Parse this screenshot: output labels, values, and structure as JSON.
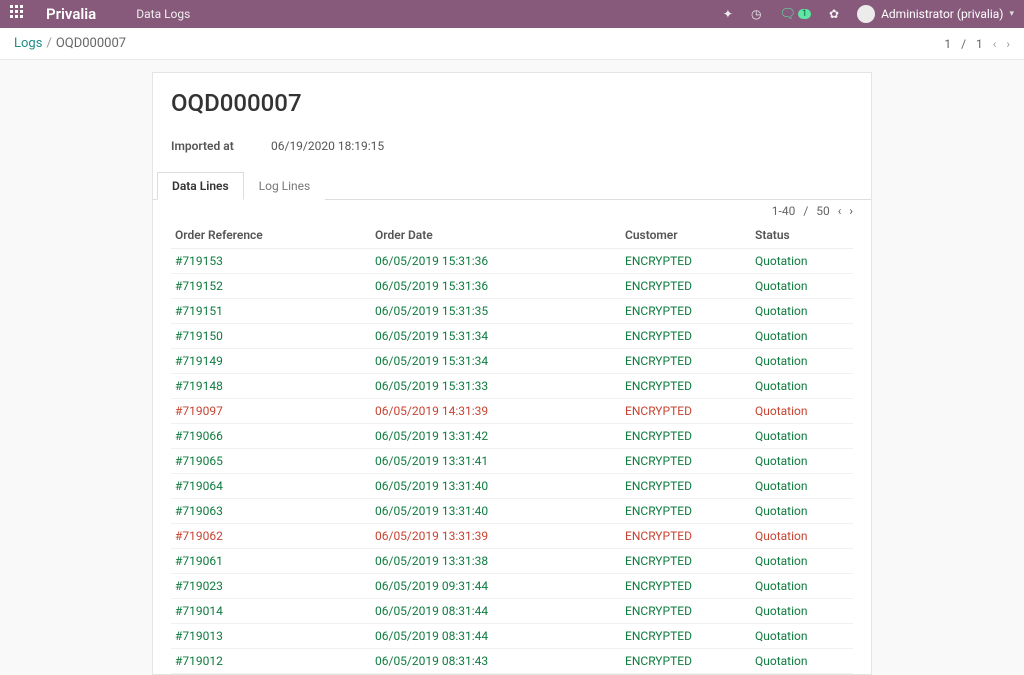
{
  "navbar": {
    "brand": "Privalia",
    "menu": "Data Logs",
    "chat_badge": "1",
    "user": "Administrator (privalia)"
  },
  "breadcrumb": {
    "root": "Logs",
    "current": "OQD000007"
  },
  "pager_top": {
    "value": "1",
    "total": "1"
  },
  "record": {
    "title": "OQD000007",
    "imported_at_label": "Imported at",
    "imported_at": "06/19/2020 18:19:15"
  },
  "tabs": {
    "data_lines": "Data Lines",
    "log_lines": "Log Lines"
  },
  "table_pager": {
    "range": "1-40",
    "total": "50"
  },
  "columns": {
    "ref": "Order Reference",
    "date": "Order Date",
    "cust": "Customer",
    "status": "Status"
  },
  "rows": [
    {
      "ref": "#719153",
      "date": "06/05/2019 15:31:36",
      "cust": "ENCRYPTED",
      "status": "Quotation",
      "tone": "green"
    },
    {
      "ref": "#719152",
      "date": "06/05/2019 15:31:36",
      "cust": "ENCRYPTED",
      "status": "Quotation",
      "tone": "green"
    },
    {
      "ref": "#719151",
      "date": "06/05/2019 15:31:35",
      "cust": "ENCRYPTED",
      "status": "Quotation",
      "tone": "green"
    },
    {
      "ref": "#719150",
      "date": "06/05/2019 15:31:34",
      "cust": "ENCRYPTED",
      "status": "Quotation",
      "tone": "green"
    },
    {
      "ref": "#719149",
      "date": "06/05/2019 15:31:34",
      "cust": "ENCRYPTED",
      "status": "Quotation",
      "tone": "green"
    },
    {
      "ref": "#719148",
      "date": "06/05/2019 15:31:33",
      "cust": "ENCRYPTED",
      "status": "Quotation",
      "tone": "green"
    },
    {
      "ref": "#719097",
      "date": "06/05/2019 14:31:39",
      "cust": "ENCRYPTED",
      "status": "Quotation",
      "tone": "red"
    },
    {
      "ref": "#719066",
      "date": "06/05/2019 13:31:42",
      "cust": "ENCRYPTED",
      "status": "Quotation",
      "tone": "green"
    },
    {
      "ref": "#719065",
      "date": "06/05/2019 13:31:41",
      "cust": "ENCRYPTED",
      "status": "Quotation",
      "tone": "green"
    },
    {
      "ref": "#719064",
      "date": "06/05/2019 13:31:40",
      "cust": "ENCRYPTED",
      "status": "Quotation",
      "tone": "green"
    },
    {
      "ref": "#719063",
      "date": "06/05/2019 13:31:40",
      "cust": "ENCRYPTED",
      "status": "Quotation",
      "tone": "green"
    },
    {
      "ref": "#719062",
      "date": "06/05/2019 13:31:39",
      "cust": "ENCRYPTED",
      "status": "Quotation",
      "tone": "red"
    },
    {
      "ref": "#719061",
      "date": "06/05/2019 13:31:38",
      "cust": "ENCRYPTED",
      "status": "Quotation",
      "tone": "green"
    },
    {
      "ref": "#719023",
      "date": "06/05/2019 09:31:44",
      "cust": "ENCRYPTED",
      "status": "Quotation",
      "tone": "green"
    },
    {
      "ref": "#719014",
      "date": "06/05/2019 08:31:44",
      "cust": "ENCRYPTED",
      "status": "Quotation",
      "tone": "green"
    },
    {
      "ref": "#719013",
      "date": "06/05/2019 08:31:44",
      "cust": "ENCRYPTED",
      "status": "Quotation",
      "tone": "green"
    },
    {
      "ref": "#719012",
      "date": "06/05/2019 08:31:43",
      "cust": "ENCRYPTED",
      "status": "Quotation",
      "tone": "green"
    }
  ]
}
